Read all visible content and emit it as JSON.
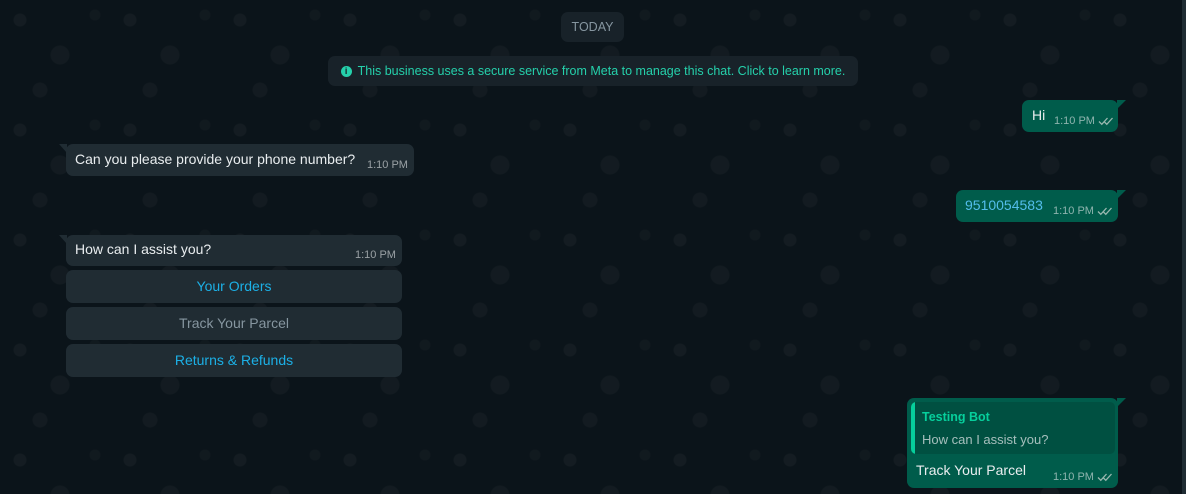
{
  "chat": {
    "date_separator": "TODAY",
    "system_notice": "This business uses a secure service from Meta to manage this chat. Click to learn more.",
    "messages": [
      {
        "direction": "outgoing",
        "text": "Hi",
        "time": "1:10 PM",
        "status": "read"
      },
      {
        "direction": "incoming",
        "text": "Can you please provide your phone number?",
        "time": "1:10 PM"
      },
      {
        "direction": "outgoing",
        "text": "9510054583",
        "time": "1:10 PM",
        "status": "read"
      },
      {
        "direction": "incoming",
        "text": "How can I assist you?",
        "time": "1:10 PM"
      },
      {
        "direction": "outgoing",
        "text": "Track Your Parcel",
        "time": "1:10 PM",
        "status": "read",
        "quoted": {
          "author": "Testing Bot",
          "text": "How can I assist you?"
        }
      }
    ],
    "quick_replies": [
      {
        "label": "Your Orders",
        "state": "active"
      },
      {
        "label": "Track Your Parcel",
        "state": "disabled"
      },
      {
        "label": "Returns & Refunds",
        "state": "active"
      }
    ]
  },
  "theme": {
    "background": "#0b141a",
    "incoming_bubble": "#202c33",
    "outgoing_bubble": "#005c4b",
    "accent_teal": "#06cf9c",
    "link_blue": "#1cb0e6",
    "icons": {
      "read_receipt": "double-check-icon",
      "notice": "info-icon"
    }
  }
}
